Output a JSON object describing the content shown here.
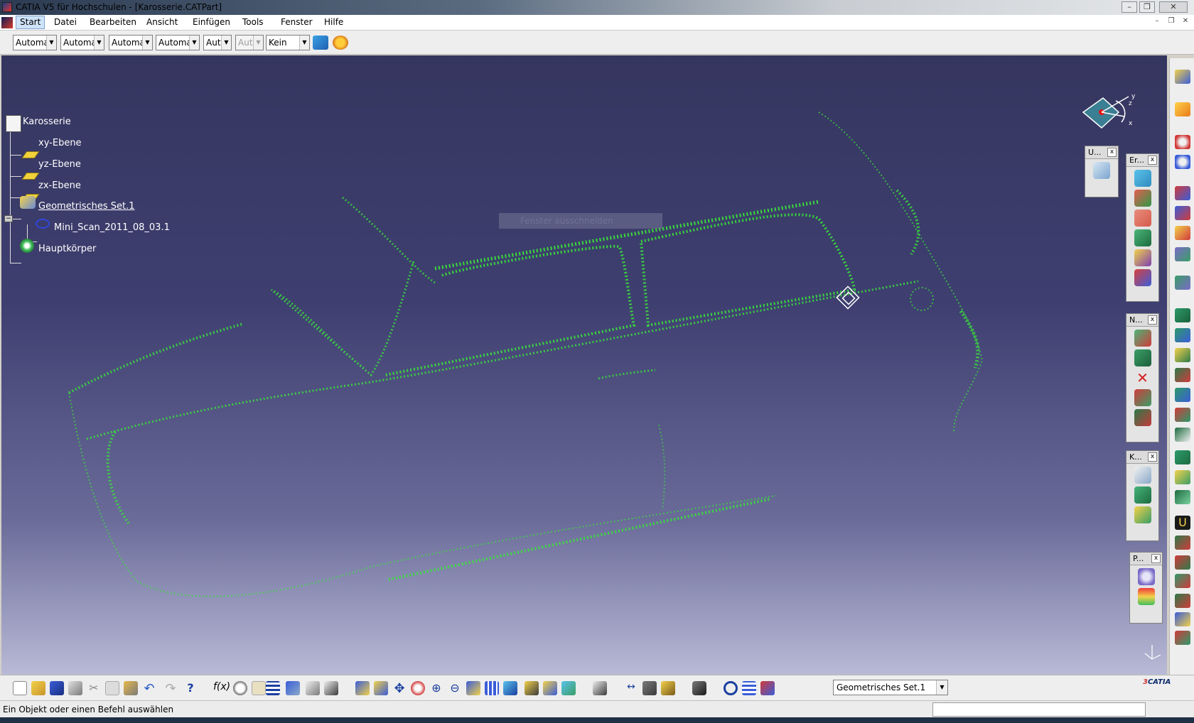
{
  "window": {
    "title": "CATIA V5 für Hochschulen - [Karosserie.CATPart]",
    "controls": [
      "minimize",
      "restore",
      "close"
    ]
  },
  "menubar": {
    "items": [
      "Start",
      "Datei",
      "Bearbeiten",
      "Ansicht",
      "Einfügen",
      "Tools",
      "Fenster",
      "Hilfe"
    ],
    "active": "Start"
  },
  "toolbar": {
    "combos": [
      {
        "value": "Automa",
        "enabled": true
      },
      {
        "value": "Automa",
        "enabled": true
      },
      {
        "value": "Automa",
        "enabled": true
      },
      {
        "value": "Automa",
        "enabled": true
      },
      {
        "value": "Aut",
        "enabled": true
      },
      {
        "value": "Aut",
        "enabled": false
      },
      {
        "value": "Kein",
        "enabled": true
      }
    ]
  },
  "tree": {
    "root": "Karosserie",
    "nodes": [
      {
        "label": "xy-Ebene",
        "icon": "plane-icon"
      },
      {
        "label": "yz-Ebene",
        "icon": "plane-icon"
      },
      {
        "label": "zx-Ebene",
        "icon": "plane-icon"
      },
      {
        "label": "Geometrisches Set.1",
        "icon": "geometrical-set-icon"
      },
      {
        "label": "Mini_Scan_2011_08_03.1",
        "icon": "cloud-import-icon"
      },
      {
        "label": "Hauptkörper",
        "icon": "body-gear-icon"
      }
    ]
  },
  "ghost_tooltip": "Fenster ausschneiden",
  "compass_axes": [
    "x",
    "y",
    "z"
  ],
  "panels": [
    {
      "title": "U...",
      "icons": [
        "sketch-analysis-icon"
      ]
    },
    {
      "title": "Er...",
      "icons": [
        "curve-icon",
        "mesh-icon",
        "curve-offset-icon",
        "surface-icon",
        "curve-network-icon",
        "axis-icon"
      ]
    },
    {
      "title": "N...",
      "icons": [
        "mesh-point-icon",
        "mesh-fill-icon",
        "delete-icon",
        "mesh-split-icon",
        "mesh-clean-icon"
      ]
    },
    {
      "title": "K...",
      "icons": [
        "scan-curve-icon",
        "surface-patch-icon",
        "projection-icon"
      ]
    },
    {
      "title": "P...",
      "icons": [
        "cloud-planar-icon",
        "color-analysis-icon"
      ]
    }
  ],
  "status": {
    "message": "Ein Objekt oder einen Befehl auswählen",
    "current_set": "Geometrisches Set.1"
  },
  "colors": {
    "viewport_top": "#35365f",
    "viewport_bottom": "#b9bad6",
    "point_cloud": "#39e23a",
    "tree_text": "#ffffff"
  },
  "brand": "CATIA"
}
